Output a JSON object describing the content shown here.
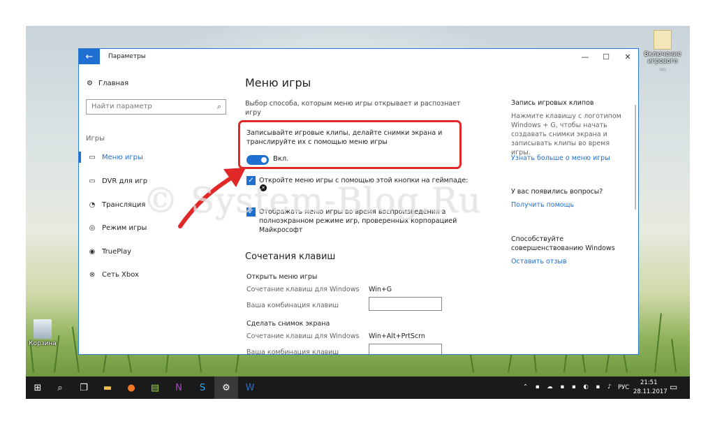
{
  "window": {
    "title": "Параметры",
    "back": "←",
    "min": "—",
    "max": "☐",
    "close": "✕"
  },
  "sidebar": {
    "home": "Главная",
    "search_placeholder": "Найти параметр",
    "group": "Игры",
    "items": [
      {
        "label": "Меню игры",
        "icon": "▭"
      },
      {
        "label": "DVR для игр",
        "icon": "▭"
      },
      {
        "label": "Трансляция",
        "icon": "◔"
      },
      {
        "label": "Режим игры",
        "icon": "◎"
      },
      {
        "label": "TruePlay",
        "icon": "◉"
      },
      {
        "label": "Сеть Xbox",
        "icon": "⊗"
      }
    ]
  },
  "main": {
    "title": "Меню игры",
    "description": "Выбор способа, которым меню игры открывает и распознает игру",
    "toggle_label": "Записывайте игровые клипы, делайте снимки экрана и транслируйте их с помощью меню игры",
    "toggle_state": "Вкл.",
    "check1": "Откройте меню игры с помощью этой кнопки на геймпаде:",
    "check2": "Отображать меню игры во время воспроизведения в полноэкранном режиме игр, проверенных корпорацией Майкрософт",
    "shortcuts_title": "Сочетания клавиш",
    "open_menu": "Открыть меню игры",
    "win_combo": "Сочетание клавиш для Windows",
    "open_menu_value": "Win+G",
    "your_combo": "Ваша комбинация клавиш",
    "screenshot": "Сделать снимок экрана",
    "screenshot_value": "Win+Alt+PrtScrn"
  },
  "right": {
    "title": "Запись игровых клипов",
    "text": "Нажмите клавишу с логотипом Windows + G, чтобы начать создавать снимки экрана и записывать клипы во время игры.",
    "link": "Узнать больше о меню игры",
    "q_title": "У вас появились вопросы?",
    "q_link": "Получить помощь",
    "imp_title": "Способствуйте совершенствованию Windows",
    "imp_link": "Оставить отзыв"
  },
  "desktop": {
    "icon1": "Включение игрового ...",
    "icon2": "Корзина"
  },
  "watermark": "© System-Blog.Ru",
  "taskbar": {
    "lang": "РУС",
    "time": "21:51",
    "date": "28.11.2017"
  }
}
